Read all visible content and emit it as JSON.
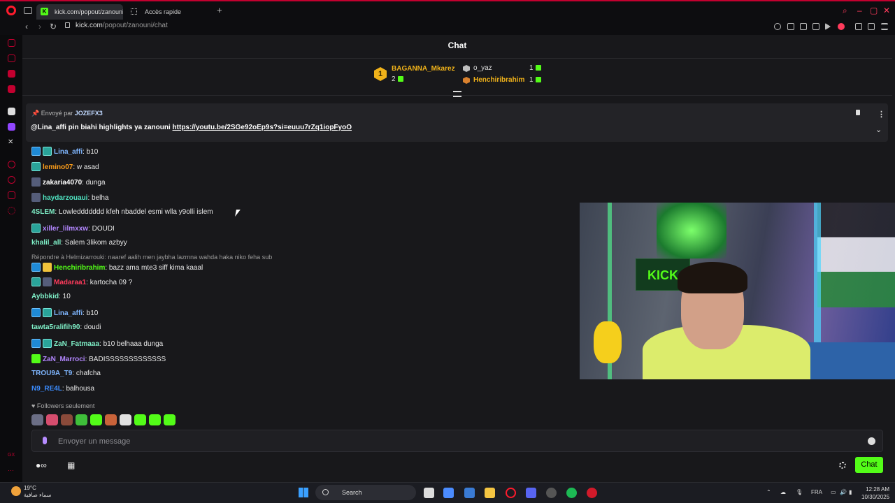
{
  "browser": {
    "tabs": [
      {
        "label": "kick.com/popout/zanouni",
        "active": true
      },
      {
        "label": "Accès rapide",
        "active": false
      }
    ],
    "url_domain": "kick.com",
    "url_path": "/popout/zanouni/chat"
  },
  "chat": {
    "title": "Chat",
    "leaderboard": [
      {
        "rank": "1",
        "name": "BAGANNA_Mkarez",
        "count": "2"
      },
      {
        "rank": "2",
        "name": "o_yaz",
        "count": "1"
      },
      {
        "rank": "3",
        "name": "Henchiribrahim",
        "count": "1"
      }
    ],
    "pinned": {
      "sent_by_label": "Envoyé par",
      "sent_by": "JOZEFX3",
      "mention": "@Lina_affi pin biahi highlights ya zanouni",
      "link": "https://youtu.be/2SGe92oEp9s?si=euuu7rZq1iopFyoO"
    },
    "messages": [
      {
        "user": "Lina_affi",
        "text": ": b10",
        "color": "#7fb6ff",
        "badges": [
          "vip",
          "sub"
        ]
      },
      {
        "user": "lemino07",
        "text": ": w asad",
        "color": "#ff9f1a",
        "badges": [
          "sub"
        ]
      },
      {
        "user": "zakaria4070",
        "text": ": dunga",
        "color": "#ffffff",
        "badges": [
          "avatar"
        ]
      },
      {
        "user": "haydarzouaui",
        "text": ": belha",
        "color": "#4fe3c1",
        "badges": [
          "avatar"
        ]
      },
      {
        "user": "4SLEM",
        "text": ": Lowleddddddd kfeh nbaddel esmi wlla y9olli islem",
        "color": "#7ff0c8",
        "badges": []
      },
      {
        "user": "xiller_lilmxxw",
        "text": ": DOUDI",
        "color": "#b387ff",
        "badges": [
          "sub"
        ]
      },
      {
        "user": "khalil_all",
        "text": ": Salem 3likom azbyy",
        "color": "#7ff0c8",
        "badges": []
      },
      {
        "user": "Henchiribrahim",
        "text": ": bazz ama mte3 siff kima kaaal",
        "color": "#53fc18",
        "badges": [
          "vip",
          "crown"
        ]
      },
      {
        "user": "Madaraa1",
        "text": ": kartocha 09 ?",
        "color": "#ff3b5c",
        "badges": [
          "sub",
          "avatar"
        ]
      },
      {
        "user": "Aybbkid",
        "text": ": 10",
        "color": "#7ff0c8",
        "badges": []
      },
      {
        "user": "Lina_affi",
        "text": ": b10",
        "color": "#7fb6ff",
        "badges": [
          "vip",
          "sub"
        ]
      },
      {
        "user": "tawta5ralifih90",
        "text": ": doudi",
        "color": "#7ff0c8",
        "badges": []
      },
      {
        "user": "ZaN_Fatmaaa",
        "text": ": b10 belhaaa dunga",
        "color": "#7ff0c8",
        "badges": [
          "vip",
          "sub"
        ]
      },
      {
        "user": "ZaN_Marroci",
        "text": ": BADISSSSSSSSSSSSS",
        "color": "#b387ff",
        "badges": [
          "gift"
        ]
      },
      {
        "user": "TROU9A_T9",
        "text": ": chafcha",
        "color": "#7fb6ff",
        "badges": []
      },
      {
        "user": "N9_RE4L",
        "text": ": balhousa",
        "color": "#3b8cff",
        "badges": []
      }
    ],
    "reply_preview": "Répondre à Helmizarrouki: naaref aalih men jaybha lazmna wahda haka niko feha sub",
    "followers_label": "Followers seulement",
    "input_placeholder": "Envoyer un message",
    "send_label": "Chat"
  },
  "taskbar": {
    "temperature": "19°C",
    "weather_desc": "سماء صافية",
    "search_label": "Search",
    "language": "FRA",
    "time": "12:28 AM",
    "date": "10/30/2025"
  },
  "cam": {
    "logo_text": "KICK"
  },
  "accent": "#53fc18"
}
